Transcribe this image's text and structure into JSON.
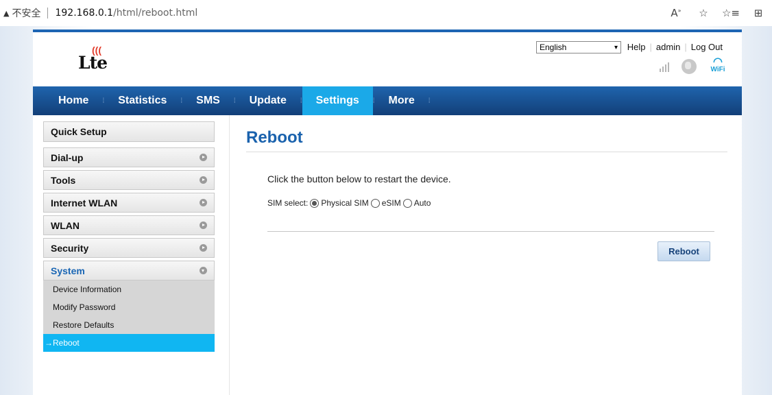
{
  "browser": {
    "warning": "▲",
    "insecure_label": "不安全",
    "url_host": "192.168.0.1",
    "url_path": "/html/reboot.html"
  },
  "header": {
    "logo_text": "Lte",
    "language": "English",
    "links": [
      "Help",
      "admin",
      "Log Out"
    ],
    "wifi_label": "WiFi"
  },
  "nav": {
    "items": [
      "Home",
      "Statistics",
      "SMS",
      "Update",
      "Settings",
      "More"
    ],
    "active": "Settings"
  },
  "sidebar": {
    "items": [
      "Quick Setup",
      "Dial-up",
      "Tools",
      "Internet WLAN",
      "WLAN",
      "Security",
      "System"
    ],
    "sub_items": [
      "Device Information",
      "Modify Password",
      "Restore Defaults",
      "→Reboot"
    ]
  },
  "content": {
    "title": "Reboot",
    "description": "Click the button below to restart the device.",
    "sim_label": "SIM select:",
    "sim_options": [
      "Physical SIM",
      "eSIM",
      "Auto"
    ],
    "sim_selected": "Physical SIM",
    "reboot_button": "Reboot"
  },
  "colors": {
    "nav_blue": "#1d65b3",
    "active_tab": "#1ba9e8",
    "title_blue": "#1a62ad",
    "active_sub": "#10b6f2"
  }
}
